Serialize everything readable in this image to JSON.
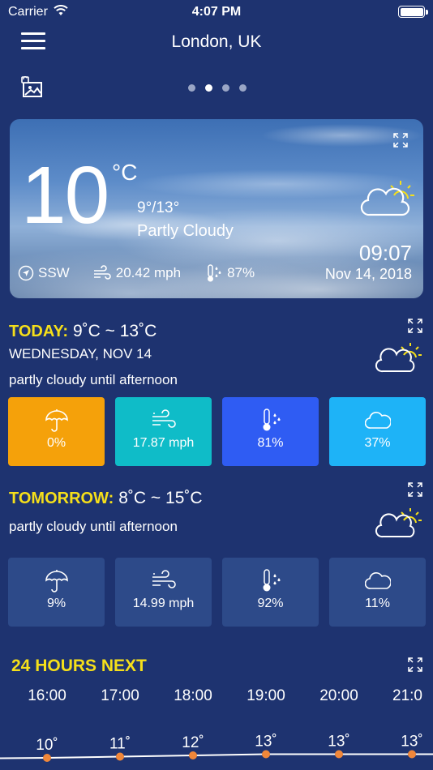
{
  "status_bar": {
    "carrier": "Carrier",
    "time": "4:07 PM"
  },
  "header": {
    "city": "London, UK",
    "page_dots": 4,
    "active_dot": 1
  },
  "current": {
    "temp": "10",
    "unit": "°C",
    "range": "9°/13°",
    "condition": "Partly Cloudy",
    "wind_dir": "SSW",
    "wind_speed": "20.42 mph",
    "humidity": "87%",
    "time": "09:07",
    "date": "Nov 14, 2018"
  },
  "today": {
    "label": "TODAY:",
    "range": "9˚C ~ 13˚C",
    "day": "WEDNESDAY, NOV 14",
    "summary": "partly cloudy until afternoon",
    "tiles": [
      {
        "icon": "umbrella-icon",
        "value": "0%",
        "color": "#f5a10a"
      },
      {
        "icon": "wind-icon",
        "value": "17.87 mph",
        "color": "#0fbcc8"
      },
      {
        "icon": "thermometer-drops-icon",
        "value": "81%",
        "color": "#2f5cf3"
      },
      {
        "icon": "cloud-icon",
        "value": "37%",
        "color": "#1eb3f7"
      }
    ]
  },
  "tomorrow": {
    "label": "TOMORROW:",
    "range": "8˚C ~ 15˚C",
    "summary": "partly cloudy until afternoon",
    "tiles": [
      {
        "icon": "umbrella-icon",
        "value": "9%"
      },
      {
        "icon": "wind-icon",
        "value": "14.99 mph"
      },
      {
        "icon": "thermometer-drops-icon",
        "value": "92%"
      },
      {
        "icon": "cloud-icon",
        "value": "11%"
      }
    ]
  },
  "hourly": {
    "title": "24 HOURS NEXT",
    "hours": [
      "16:00",
      "17:00",
      "18:00",
      "19:00",
      "20:00",
      "21:0"
    ],
    "temps": [
      "10˚",
      "11˚",
      "12˚",
      "13˚",
      "13˚",
      "13˚"
    ],
    "temp_values": [
      10,
      11,
      12,
      13,
      13,
      13
    ],
    "line_color": "#ffffff",
    "point_color": "#f0873a"
  },
  "colors": {
    "background": "#1e3370",
    "accent_yellow": "#f5df1a"
  }
}
